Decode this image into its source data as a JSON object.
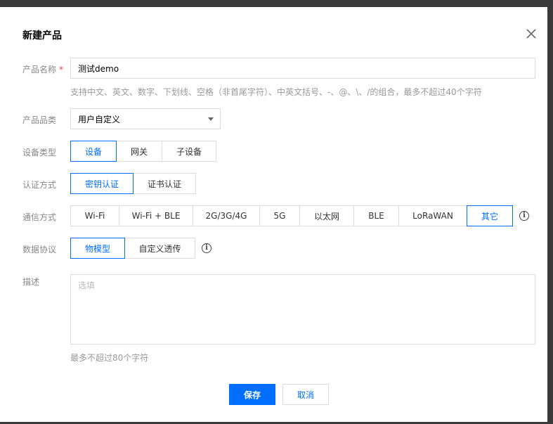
{
  "dialog": {
    "title": "新建产品"
  },
  "form": {
    "name": {
      "label": "产品名称",
      "required_mark": "*",
      "value": "测试demo",
      "hint": "支持中文、英文、数字、下划线、空格（非首尾字符）、中英文括号、-、@、\\、/的组合，最多不超过40个字符"
    },
    "category": {
      "label": "产品品类",
      "value": "用户自定义"
    },
    "device_type": {
      "label": "设备类型",
      "options": [
        "设备",
        "网关",
        "子设备"
      ],
      "selected": "设备"
    },
    "auth": {
      "label": "认证方式",
      "options": [
        "密钥认证",
        "证书认证"
      ],
      "selected": "密钥认证"
    },
    "comm": {
      "label": "通信方式",
      "options": [
        "Wi-Fi",
        "Wi-Fi + BLE",
        "2G/3G/4G",
        "5G",
        "以太网",
        "BLE",
        "LoRaWAN",
        "其它"
      ],
      "selected": "其它",
      "info_icon": "i"
    },
    "protocol": {
      "label": "数据协议",
      "options": [
        "物模型",
        "自定义透传"
      ],
      "selected": "物模型",
      "info_icon": "i"
    },
    "description": {
      "label": "描述",
      "placeholder": "选填",
      "hint": "最多不超过80个字符"
    }
  },
  "footer": {
    "save_label": "保存",
    "cancel_label": "取消"
  },
  "colors": {
    "accent": "#006eff",
    "required": "#e54545",
    "border": "#dcdcdc"
  }
}
